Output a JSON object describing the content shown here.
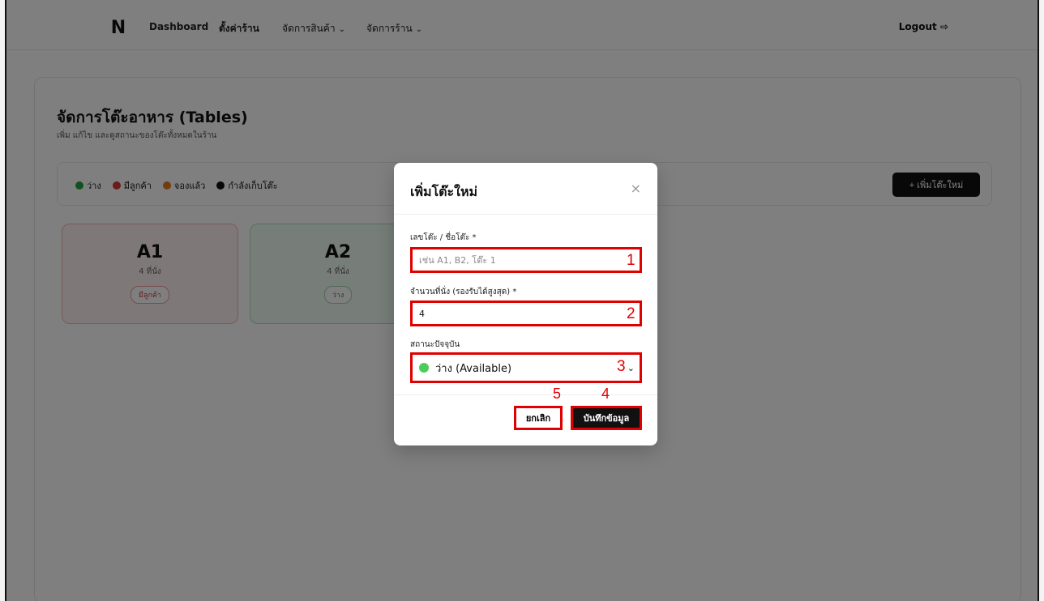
{
  "nav": {
    "logo": "N",
    "links": [
      "Dashboard",
      "ตั้งค่าร้าน",
      "จัดการสินค้า",
      "จัดการร้าน"
    ],
    "logout": "Logout",
    "logout_icon": "⇨"
  },
  "page": {
    "title": "จัดการโต๊ะอาหาร (Tables)",
    "subtitle": "เพิ่ม แก้ไข และดูสถานะของโต๊ะทั้งหมดในร้าน"
  },
  "legend": [
    {
      "label": "ว่าง",
      "color": "#22a33a"
    },
    {
      "label": "มีลูกค้า",
      "color": "#d63636"
    },
    {
      "label": "จองแล้ว",
      "color": "#e17a1f"
    },
    {
      "label": "กำลังเก็บโต๊ะ",
      "color": "#111111"
    }
  ],
  "add_button": "+ เพิ่มโต๊ะใหม่",
  "tables": [
    {
      "name": "A1",
      "seats": "4 ที่นั่ง",
      "status": "มีลูกค้า"
    },
    {
      "name": "A2",
      "seats": "4 ที่นั่ง",
      "status": "ว่าง"
    }
  ],
  "modal": {
    "title": "เพิ่มโต๊ะใหม่",
    "close": "×",
    "name_label": "เลขโต๊ะ / ชื่อโต๊ะ *",
    "name_placeholder": "เช่น A1, B2, โต๊ะ 1",
    "seats_label": "จำนวนที่นั่ง (รองรับได้สูงสุด) *",
    "seats_value": "4",
    "status_label": "สถานะปัจจุบัน",
    "status_value": "ว่าง (Available)",
    "cancel": "ยกเลิก",
    "save": "บันทึกข้อมูล"
  },
  "annotations": [
    "1",
    "2",
    "3",
    "4",
    "5"
  ]
}
